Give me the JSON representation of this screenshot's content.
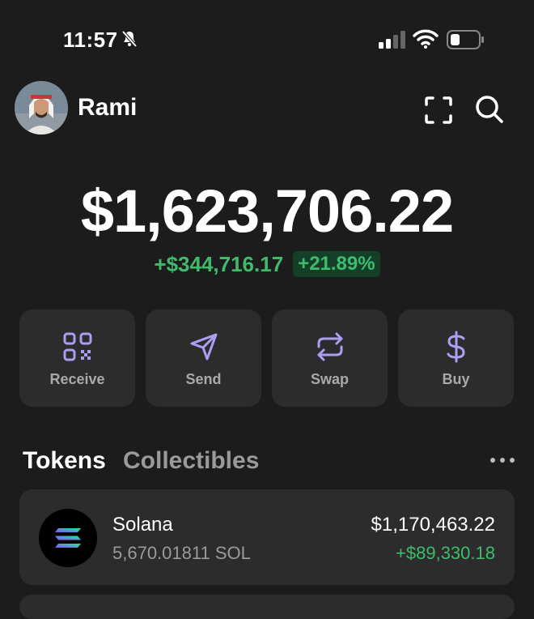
{
  "status_bar": {
    "time": "11:57",
    "icons": [
      "bell-slash-icon",
      "cellular-signal-icon",
      "wifi-icon",
      "battery-icon"
    ]
  },
  "header": {
    "username": "Rami",
    "icons": [
      "scan-icon",
      "search-icon"
    ]
  },
  "portfolio": {
    "balance": "$1,623,706.22",
    "change_amount": "+$344,716.17",
    "change_percent": "+21.89%"
  },
  "actions": [
    {
      "label": "Receive",
      "icon": "qr-code-icon"
    },
    {
      "label": "Send",
      "icon": "send-icon"
    },
    {
      "label": "Swap",
      "icon": "swap-icon"
    },
    {
      "label": "Buy",
      "icon": "dollar-icon"
    }
  ],
  "tabs": {
    "tokens": "Tokens",
    "collectibles": "Collectibles"
  },
  "tokens": [
    {
      "name": "Solana",
      "amount": "5,670.01811 SOL",
      "value": "$1,170,463.22",
      "change": "+$89,330.18",
      "icon": "solana-logo-icon"
    }
  ],
  "colors": {
    "background": "#1c1c1c",
    "card": "#2c2c2c",
    "positive": "#3fbb6c",
    "accent": "#ab9ff2"
  }
}
